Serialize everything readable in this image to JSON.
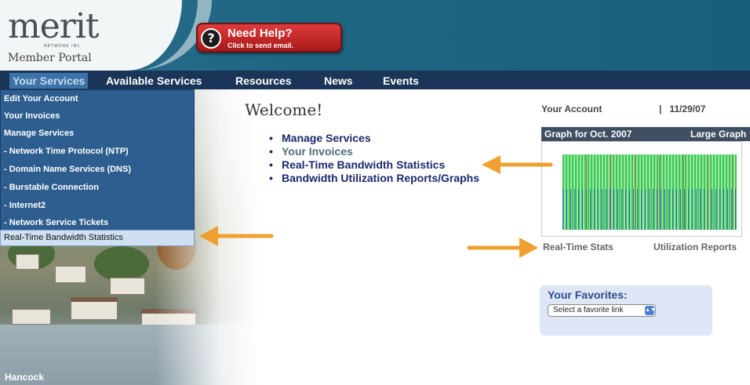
{
  "header": {
    "logo": "merit",
    "logo_sub": "NETWORK INC",
    "portal_label": "Member Portal",
    "help_title": "Need Help?",
    "help_sub": "Click to send email.",
    "help_icon": "question-mark-icon"
  },
  "nav": {
    "items": [
      {
        "label": "Your Services"
      },
      {
        "label": "Available Services"
      },
      {
        "label": "Resources"
      },
      {
        "label": "News"
      },
      {
        "label": "Events"
      }
    ]
  },
  "dropdown": {
    "items": [
      {
        "label": "Edit Your Account"
      },
      {
        "label": "Your Invoices"
      },
      {
        "label": "Manage Services"
      },
      {
        "label": "- Network Time Protocol (NTP)"
      },
      {
        "label": "- Domain Name Services (DNS)"
      },
      {
        "label": "- Burstable Connection"
      },
      {
        "label": "- Internet2"
      },
      {
        "label": "- Network Service Tickets"
      }
    ],
    "selected": "Real-Time Bandwidth Statistics"
  },
  "photo_caption": "Hancock",
  "main": {
    "welcome": "Welcome!",
    "links": [
      {
        "label": "Manage Services"
      },
      {
        "label": "Your Invoices"
      },
      {
        "label": "Real-Time Bandwidth Statistics"
      },
      {
        "label": "Bandwidth Utilization Reports/Graphs"
      }
    ]
  },
  "account": {
    "title": "Your Account",
    "separator": "|",
    "date": "11/29/07",
    "graph_title": "Graph for Oct. 2007",
    "graph_large": "Large Graph",
    "realtime_stats": "Real-Time Stats",
    "utilization_reports": "Utilization Reports"
  },
  "favorites": {
    "title": "Your Favorites:",
    "select_value": "Select a favorite link"
  },
  "colors": {
    "header_blue": "#1f6683",
    "nav_dark": "#1a3558",
    "menu_blue": "#2d5e8f",
    "link_navy": "#1a2a6c",
    "arrow_orange": "#f0a030",
    "help_red": "#c42525"
  }
}
